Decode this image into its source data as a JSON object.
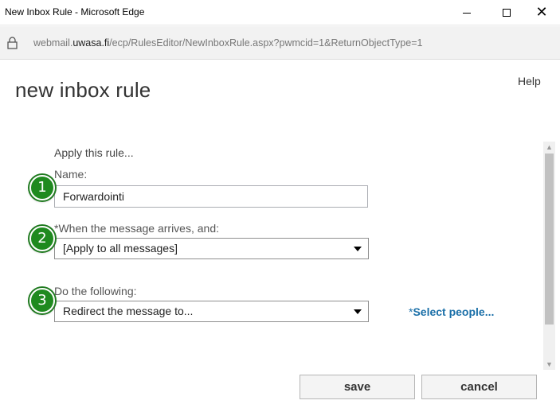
{
  "window": {
    "title": "New Inbox Rule - Microsoft Edge",
    "minimize_glyph": "",
    "close_glyph": "✕"
  },
  "address": {
    "prefix": "webmail.",
    "host": "uwasa.fi",
    "path": "/ecp/RulesEditor/NewInboxRule.aspx?pwmcid=1&ReturnObjectType=1"
  },
  "page": {
    "title": "new inbox rule",
    "help": "Help",
    "apply_label": "Apply this rule..."
  },
  "form": {
    "name_label": "Name:",
    "name_value": "Forwardointi",
    "when_label": "*When the message arrives, and:",
    "when_value": "[Apply to all messages]",
    "do_label": "Do the following:",
    "do_value": "Redirect the message to...",
    "select_people_star": "*",
    "select_people": "Select people..."
  },
  "badges": [
    "1",
    "2",
    "3"
  ],
  "buttons": {
    "save": "save",
    "cancel": "cancel"
  },
  "colors": {
    "badge_green": "#1f8a1f",
    "link_blue": "#1a6fa8"
  }
}
